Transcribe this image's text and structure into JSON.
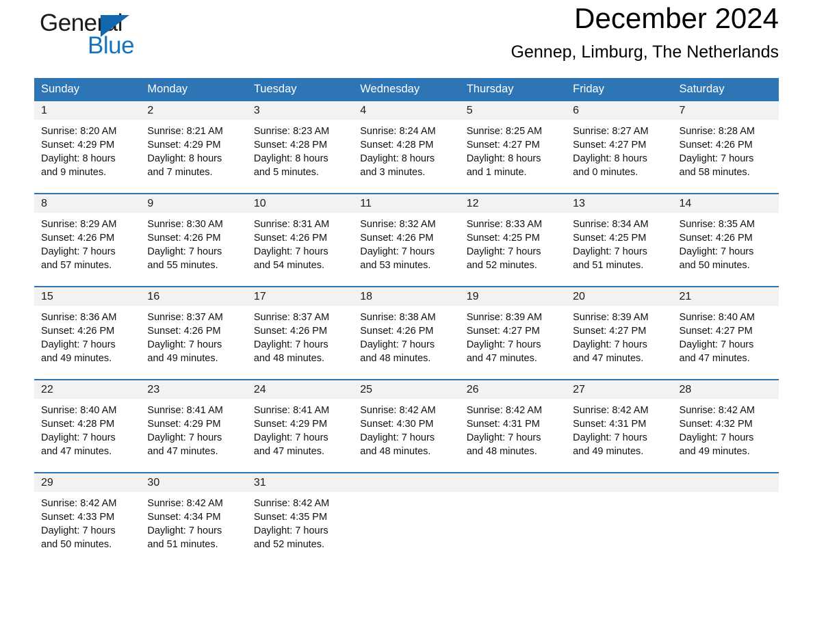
{
  "brand": {
    "name_part1": "General",
    "name_part2": "Blue",
    "triangle_icon": "triangle-icon",
    "accent_black": "#1a1a1a",
    "accent_blue": "#1574bf"
  },
  "header": {
    "month_title": "December 2024",
    "location": "Gennep, Limburg, The Netherlands"
  },
  "theme": {
    "header_blue": "#2e75b6",
    "daynum_band": "#f2f2f2",
    "text_black": "#111111"
  },
  "weekdays": [
    "Sunday",
    "Monday",
    "Tuesday",
    "Wednesday",
    "Thursday",
    "Friday",
    "Saturday"
  ],
  "weeks": [
    {
      "days": [
        {
          "num": "1",
          "sunrise": "Sunrise: 8:20 AM",
          "sunset": "Sunset: 4:29 PM",
          "daylight_line1": "Daylight: 8 hours",
          "daylight_line2": "and 9 minutes."
        },
        {
          "num": "2",
          "sunrise": "Sunrise: 8:21 AM",
          "sunset": "Sunset: 4:29 PM",
          "daylight_line1": "Daylight: 8 hours",
          "daylight_line2": "and 7 minutes."
        },
        {
          "num": "3",
          "sunrise": "Sunrise: 8:23 AM",
          "sunset": "Sunset: 4:28 PM",
          "daylight_line1": "Daylight: 8 hours",
          "daylight_line2": "and 5 minutes."
        },
        {
          "num": "4",
          "sunrise": "Sunrise: 8:24 AM",
          "sunset": "Sunset: 4:28 PM",
          "daylight_line1": "Daylight: 8 hours",
          "daylight_line2": "and 3 minutes."
        },
        {
          "num": "5",
          "sunrise": "Sunrise: 8:25 AM",
          "sunset": "Sunset: 4:27 PM",
          "daylight_line1": "Daylight: 8 hours",
          "daylight_line2": "and 1 minute."
        },
        {
          "num": "6",
          "sunrise": "Sunrise: 8:27 AM",
          "sunset": "Sunset: 4:27 PM",
          "daylight_line1": "Daylight: 8 hours",
          "daylight_line2": "and 0 minutes."
        },
        {
          "num": "7",
          "sunrise": "Sunrise: 8:28 AM",
          "sunset": "Sunset: 4:26 PM",
          "daylight_line1": "Daylight: 7 hours",
          "daylight_line2": "and 58 minutes."
        }
      ]
    },
    {
      "days": [
        {
          "num": "8",
          "sunrise": "Sunrise: 8:29 AM",
          "sunset": "Sunset: 4:26 PM",
          "daylight_line1": "Daylight: 7 hours",
          "daylight_line2": "and 57 minutes."
        },
        {
          "num": "9",
          "sunrise": "Sunrise: 8:30 AM",
          "sunset": "Sunset: 4:26 PM",
          "daylight_line1": "Daylight: 7 hours",
          "daylight_line2": "and 55 minutes."
        },
        {
          "num": "10",
          "sunrise": "Sunrise: 8:31 AM",
          "sunset": "Sunset: 4:26 PM",
          "daylight_line1": "Daylight: 7 hours",
          "daylight_line2": "and 54 minutes."
        },
        {
          "num": "11",
          "sunrise": "Sunrise: 8:32 AM",
          "sunset": "Sunset: 4:26 PM",
          "daylight_line1": "Daylight: 7 hours",
          "daylight_line2": "and 53 minutes."
        },
        {
          "num": "12",
          "sunrise": "Sunrise: 8:33 AM",
          "sunset": "Sunset: 4:25 PM",
          "daylight_line1": "Daylight: 7 hours",
          "daylight_line2": "and 52 minutes."
        },
        {
          "num": "13",
          "sunrise": "Sunrise: 8:34 AM",
          "sunset": "Sunset: 4:25 PM",
          "daylight_line1": "Daylight: 7 hours",
          "daylight_line2": "and 51 minutes."
        },
        {
          "num": "14",
          "sunrise": "Sunrise: 8:35 AM",
          "sunset": "Sunset: 4:26 PM",
          "daylight_line1": "Daylight: 7 hours",
          "daylight_line2": "and 50 minutes."
        }
      ]
    },
    {
      "days": [
        {
          "num": "15",
          "sunrise": "Sunrise: 8:36 AM",
          "sunset": "Sunset: 4:26 PM",
          "daylight_line1": "Daylight: 7 hours",
          "daylight_line2": "and 49 minutes."
        },
        {
          "num": "16",
          "sunrise": "Sunrise: 8:37 AM",
          "sunset": "Sunset: 4:26 PM",
          "daylight_line1": "Daylight: 7 hours",
          "daylight_line2": "and 49 minutes."
        },
        {
          "num": "17",
          "sunrise": "Sunrise: 8:37 AM",
          "sunset": "Sunset: 4:26 PM",
          "daylight_line1": "Daylight: 7 hours",
          "daylight_line2": "and 48 minutes."
        },
        {
          "num": "18",
          "sunrise": "Sunrise: 8:38 AM",
          "sunset": "Sunset: 4:26 PM",
          "daylight_line1": "Daylight: 7 hours",
          "daylight_line2": "and 48 minutes."
        },
        {
          "num": "19",
          "sunrise": "Sunrise: 8:39 AM",
          "sunset": "Sunset: 4:27 PM",
          "daylight_line1": "Daylight: 7 hours",
          "daylight_line2": "and 47 minutes."
        },
        {
          "num": "20",
          "sunrise": "Sunrise: 8:39 AM",
          "sunset": "Sunset: 4:27 PM",
          "daylight_line1": "Daylight: 7 hours",
          "daylight_line2": "and 47 minutes."
        },
        {
          "num": "21",
          "sunrise": "Sunrise: 8:40 AM",
          "sunset": "Sunset: 4:27 PM",
          "daylight_line1": "Daylight: 7 hours",
          "daylight_line2": "and 47 minutes."
        }
      ]
    },
    {
      "days": [
        {
          "num": "22",
          "sunrise": "Sunrise: 8:40 AM",
          "sunset": "Sunset: 4:28 PM",
          "daylight_line1": "Daylight: 7 hours",
          "daylight_line2": "and 47 minutes."
        },
        {
          "num": "23",
          "sunrise": "Sunrise: 8:41 AM",
          "sunset": "Sunset: 4:29 PM",
          "daylight_line1": "Daylight: 7 hours",
          "daylight_line2": "and 47 minutes."
        },
        {
          "num": "24",
          "sunrise": "Sunrise: 8:41 AM",
          "sunset": "Sunset: 4:29 PM",
          "daylight_line1": "Daylight: 7 hours",
          "daylight_line2": "and 47 minutes."
        },
        {
          "num": "25",
          "sunrise": "Sunrise: 8:42 AM",
          "sunset": "Sunset: 4:30 PM",
          "daylight_line1": "Daylight: 7 hours",
          "daylight_line2": "and 48 minutes."
        },
        {
          "num": "26",
          "sunrise": "Sunrise: 8:42 AM",
          "sunset": "Sunset: 4:31 PM",
          "daylight_line1": "Daylight: 7 hours",
          "daylight_line2": "and 48 minutes."
        },
        {
          "num": "27",
          "sunrise": "Sunrise: 8:42 AM",
          "sunset": "Sunset: 4:31 PM",
          "daylight_line1": "Daylight: 7 hours",
          "daylight_line2": "and 49 minutes."
        },
        {
          "num": "28",
          "sunrise": "Sunrise: 8:42 AM",
          "sunset": "Sunset: 4:32 PM",
          "daylight_line1": "Daylight: 7 hours",
          "daylight_line2": "and 49 minutes."
        }
      ]
    },
    {
      "days": [
        {
          "num": "29",
          "sunrise": "Sunrise: 8:42 AM",
          "sunset": "Sunset: 4:33 PM",
          "daylight_line1": "Daylight: 7 hours",
          "daylight_line2": "and 50 minutes."
        },
        {
          "num": "30",
          "sunrise": "Sunrise: 8:42 AM",
          "sunset": "Sunset: 4:34 PM",
          "daylight_line1": "Daylight: 7 hours",
          "daylight_line2": "and 51 minutes."
        },
        {
          "num": "31",
          "sunrise": "Sunrise: 8:42 AM",
          "sunset": "Sunset: 4:35 PM",
          "daylight_line1": "Daylight: 7 hours",
          "daylight_line2": "and 52 minutes."
        },
        {
          "num": "",
          "sunrise": "",
          "sunset": "",
          "daylight_line1": "",
          "daylight_line2": ""
        },
        {
          "num": "",
          "sunrise": "",
          "sunset": "",
          "daylight_line1": "",
          "daylight_line2": ""
        },
        {
          "num": "",
          "sunrise": "",
          "sunset": "",
          "daylight_line1": "",
          "daylight_line2": ""
        },
        {
          "num": "",
          "sunrise": "",
          "sunset": "",
          "daylight_line1": "",
          "daylight_line2": ""
        }
      ]
    }
  ]
}
